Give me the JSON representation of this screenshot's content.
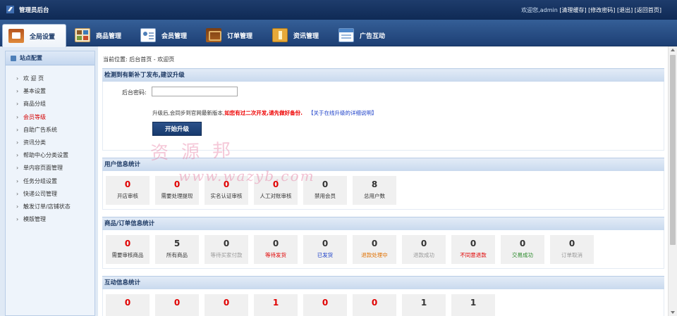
{
  "app": {
    "title": "管理员后台"
  },
  "topbar": {
    "welcome": "欢迎您,admin",
    "links": [
      "[清理缓存]",
      "[修改密码]",
      "[退出]",
      "[返回首页]"
    ]
  },
  "nav": {
    "tabs": [
      {
        "label": "全局设置",
        "icon": "home-settings-icon",
        "active": true
      },
      {
        "label": "商品管理",
        "icon": "grid-goods-icon"
      },
      {
        "label": "会员管理",
        "icon": "member-card-icon"
      },
      {
        "label": "订单管理",
        "icon": "wallet-order-icon"
      },
      {
        "label": "资讯管理",
        "icon": "folder-news-icon"
      },
      {
        "label": "广告互动",
        "icon": "window-ad-icon"
      }
    ]
  },
  "sidebar": {
    "title": "站点配置",
    "items": [
      {
        "label": "欢 迎 页"
      },
      {
        "label": "基本设置"
      },
      {
        "label": "商品分组"
      },
      {
        "label": "会员等级",
        "active": true
      },
      {
        "label": "自助广告系统"
      },
      {
        "label": "资讯分类"
      },
      {
        "label": "帮助中心分类设置"
      },
      {
        "label": "单内容页面管理"
      },
      {
        "label": "任务分组设置"
      },
      {
        "label": "快递公司管理"
      },
      {
        "label": "触发订单/店铺状态"
      },
      {
        "label": "模版管理"
      }
    ]
  },
  "breadcrumb": "当前位置: 后台首页 - 欢迎页",
  "upgrade": {
    "heading": "检测到有新补丁发布,建议升级",
    "password_label": "后台密码:",
    "password_value": "",
    "note_prefix": "升级后,会同步到官网最新版本,",
    "note_warning": "如您有过二次开发,请先做好备份.",
    "note_link": "【关于在线升级的详细说明】",
    "button": "开始升级"
  },
  "user_stats": {
    "heading": "用户信息统计",
    "items": [
      {
        "value": "0",
        "label": "开店审核",
        "color": "#e00000"
      },
      {
        "value": "0",
        "label": "需要处理提现",
        "color": "#e00000"
      },
      {
        "value": "0",
        "label": "实名认证审核",
        "color": "#e00000"
      },
      {
        "value": "0",
        "label": "人工对账审核",
        "color": "#e00000"
      },
      {
        "value": "0",
        "label": "禁用会员",
        "color": "#333333"
      },
      {
        "value": "8",
        "label": "总用户数",
        "color": "#333333"
      }
    ]
  },
  "order_stats": {
    "heading": "商品/订单信息统计",
    "items": [
      {
        "value": "0",
        "label": "需要审核商品",
        "color": "#e00000",
        "label_color": "#333333"
      },
      {
        "value": "5",
        "label": "所有商品",
        "color": "#333333",
        "label_color": "#333333"
      },
      {
        "value": "0",
        "label": "等待买家付款",
        "color": "#333333",
        "label_color": "#999999"
      },
      {
        "value": "0",
        "label": "等待发货",
        "color": "#333333",
        "label_color": "#e00000"
      },
      {
        "value": "0",
        "label": "已发货",
        "color": "#333333",
        "label_color": "#1a3ec8"
      },
      {
        "value": "0",
        "label": "退款处理中",
        "color": "#333333",
        "label_color": "#e07000"
      },
      {
        "value": "0",
        "label": "退款成功",
        "color": "#333333",
        "label_color": "#999999"
      },
      {
        "value": "0",
        "label": "不同意退款",
        "color": "#333333",
        "label_color": "#e00000"
      },
      {
        "value": "0",
        "label": "交易成功",
        "color": "#333333",
        "label_color": "#2a8a2a"
      },
      {
        "value": "0",
        "label": "订单取消",
        "color": "#333333",
        "label_color": "#999999"
      }
    ]
  },
  "interaction_stats": {
    "heading": "互动信息统计",
    "items": [
      {
        "value": "0",
        "color": "#e00000"
      },
      {
        "value": "0",
        "color": "#e00000"
      },
      {
        "value": "0",
        "color": "#e00000"
      },
      {
        "value": "1",
        "color": "#e00000"
      },
      {
        "value": "0",
        "color": "#e00000"
      },
      {
        "value": "0",
        "color": "#e00000"
      },
      {
        "value": "1",
        "color": "#333333"
      },
      {
        "value": "1",
        "color": "#333333"
      }
    ]
  },
  "watermark": {
    "line1": "资源邦",
    "line2": "www.wazyb.com"
  }
}
